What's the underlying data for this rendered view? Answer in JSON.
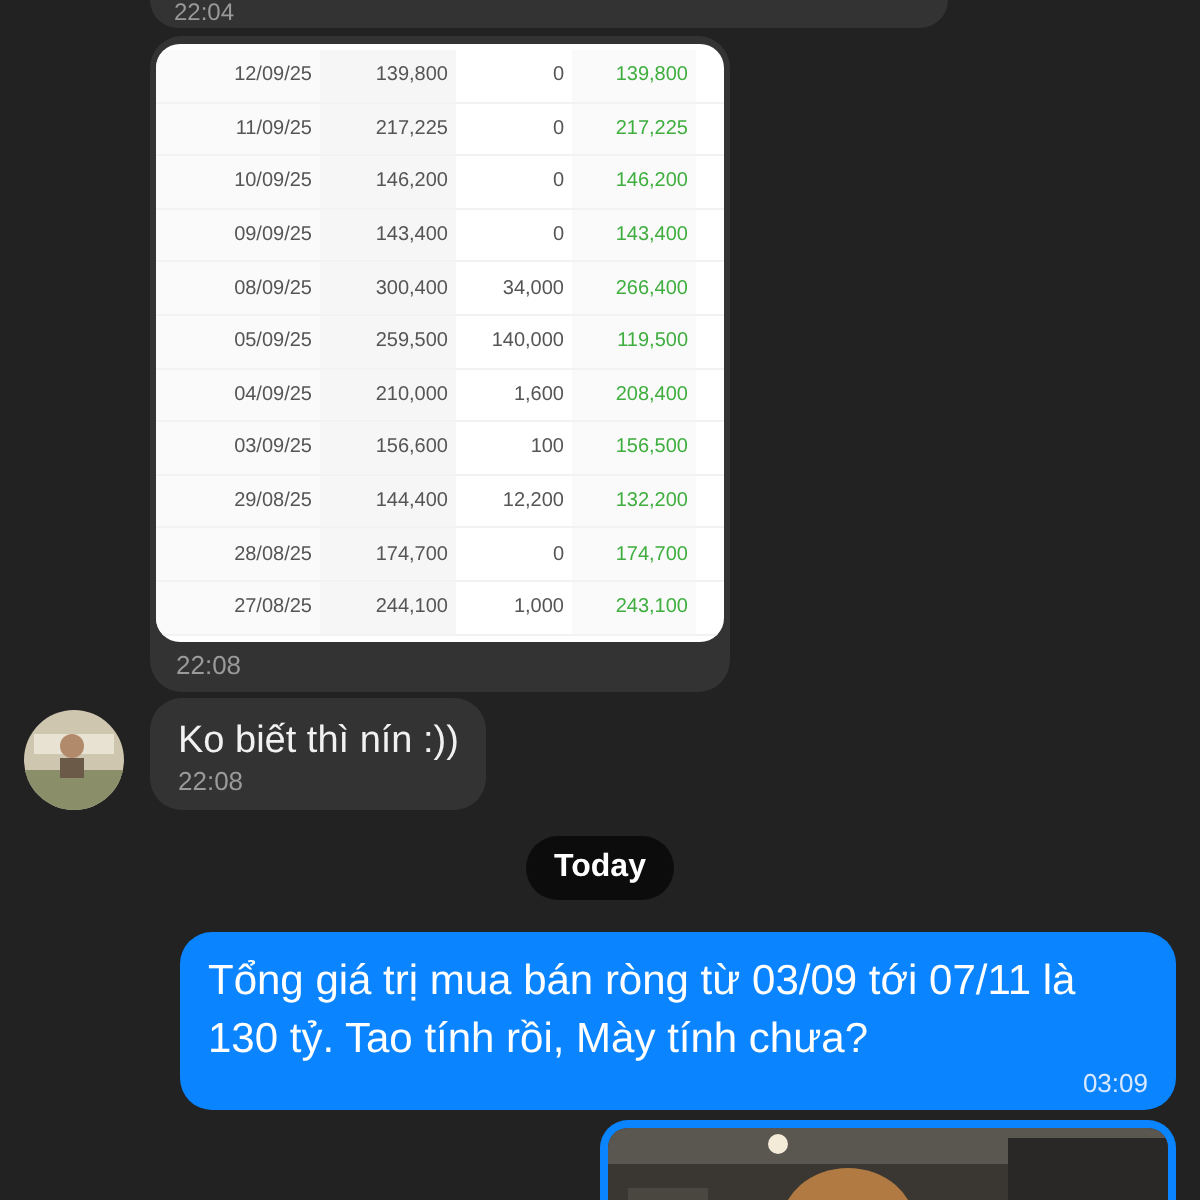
{
  "messages": [
    {
      "kind": "time_only",
      "outgoing": false,
      "time": "22:04"
    },
    {
      "kind": "table",
      "outgoing": false,
      "time": "22:08",
      "rows": [
        [
          "12/09/25",
          "139,800",
          "0",
          "139,800"
        ],
        [
          "11/09/25",
          "217,225",
          "0",
          "217,225"
        ],
        [
          "10/09/25",
          "146,200",
          "0",
          "146,200"
        ],
        [
          "09/09/25",
          "143,400",
          "0",
          "143,400"
        ],
        [
          "08/09/25",
          "300,400",
          "34,000",
          "266,400"
        ],
        [
          "05/09/25",
          "259,500",
          "140,000",
          "119,500"
        ],
        [
          "04/09/25",
          "210,000",
          "1,600",
          "208,400"
        ],
        [
          "03/09/25",
          "156,600",
          "100",
          "156,500"
        ],
        [
          "29/08/25",
          "144,400",
          "12,200",
          "132,200"
        ],
        [
          "28/08/25",
          "174,700",
          "0",
          "174,700"
        ],
        [
          "27/08/25",
          "244,100",
          "1,000",
          "243,100"
        ]
      ]
    },
    {
      "kind": "text",
      "outgoing": false,
      "avatar": true,
      "text": "Ko biết thì nín :))",
      "time": "22:08"
    },
    {
      "kind": "date",
      "text": "Today"
    },
    {
      "kind": "text",
      "outgoing": true,
      "avatar": false,
      "text": "Tổng giá trị mua bán ròng từ 03/09 tới 07/11 là 130 tỷ. Tao tính rồi, Mày tính chưa?",
      "time": "03:09"
    },
    {
      "kind": "picture",
      "outgoing": true
    }
  ]
}
